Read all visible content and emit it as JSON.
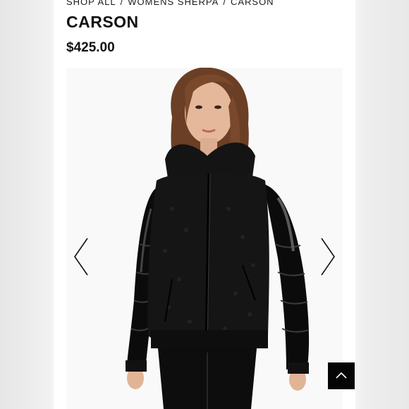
{
  "breadcrumb": {
    "items": [
      "SHOP ALL",
      "WOMENS SHERPA",
      "CARSON"
    ],
    "separator": "/"
  },
  "product": {
    "title": "CARSON",
    "price": "$425.00"
  },
  "gallery": {
    "prev_icon": "chevron-left-icon",
    "next_icon": "chevron-right-icon"
  },
  "scroll_top": {
    "icon": "chevron-up-icon",
    "background": "#050505"
  },
  "colors": {
    "text": "#111111",
    "panel": "#ffffff",
    "side": "#e9e9e9"
  }
}
